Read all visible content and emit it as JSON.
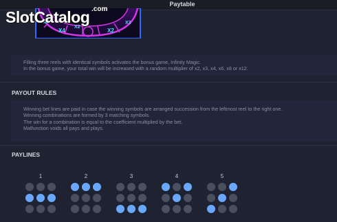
{
  "header": {
    "title": "Paytable"
  },
  "watermark": {
    "brand": "SlotCatalog",
    "suffix": ".com"
  },
  "bonus_wheel": {
    "multipliers": [
      "X3",
      "X4",
      "X2",
      "X2",
      "X3"
    ]
  },
  "bonus_info": {
    "line1": "Filling three reels with identical symbols activates the bonus game, Infinity Magic.",
    "line2": "In the bonus game, your total win will be increased with a random multiplier of x2, x3, x4, x6, x8 or x12."
  },
  "payout_rules": {
    "title": "PAYOUT RULES",
    "lines": [
      "Winning bet lines are paid in case the winning symbols are arranged succession from the leftmost reel to the right one.",
      "Winning combinations are formed by 3 matching symbols.",
      "The win for a combination is equal to the coefficient multiplied by the bet.",
      "Malfunction voids all pays and plays."
    ]
  },
  "paylines": {
    "title": "PAYLINES",
    "items": [
      {
        "number": "1",
        "pattern": [
          [
            0,
            0,
            0
          ],
          [
            1,
            1,
            1
          ],
          [
            0,
            0,
            0
          ]
        ]
      },
      {
        "number": "2",
        "pattern": [
          [
            1,
            1,
            1
          ],
          [
            0,
            0,
            0
          ],
          [
            0,
            0,
            0
          ]
        ]
      },
      {
        "number": "3",
        "pattern": [
          [
            0,
            0,
            0
          ],
          [
            0,
            0,
            0
          ],
          [
            1,
            1,
            1
          ]
        ]
      },
      {
        "number": "4",
        "pattern": [
          [
            1,
            0,
            1
          ],
          [
            0,
            1,
            0
          ],
          [
            0,
            0,
            0
          ]
        ]
      },
      {
        "number": "5",
        "pattern": [
          [
            0,
            0,
            1
          ],
          [
            0,
            1,
            0
          ],
          [
            1,
            0,
            0
          ]
        ]
      }
    ]
  },
  "colors": {
    "background": "#1f2230",
    "panel": "#23263a",
    "dot_active": "#6aa8ff",
    "dot_inactive": "#4a5060",
    "wheel_neon": "#d236e8",
    "wheel_text": "#33e6ff"
  }
}
